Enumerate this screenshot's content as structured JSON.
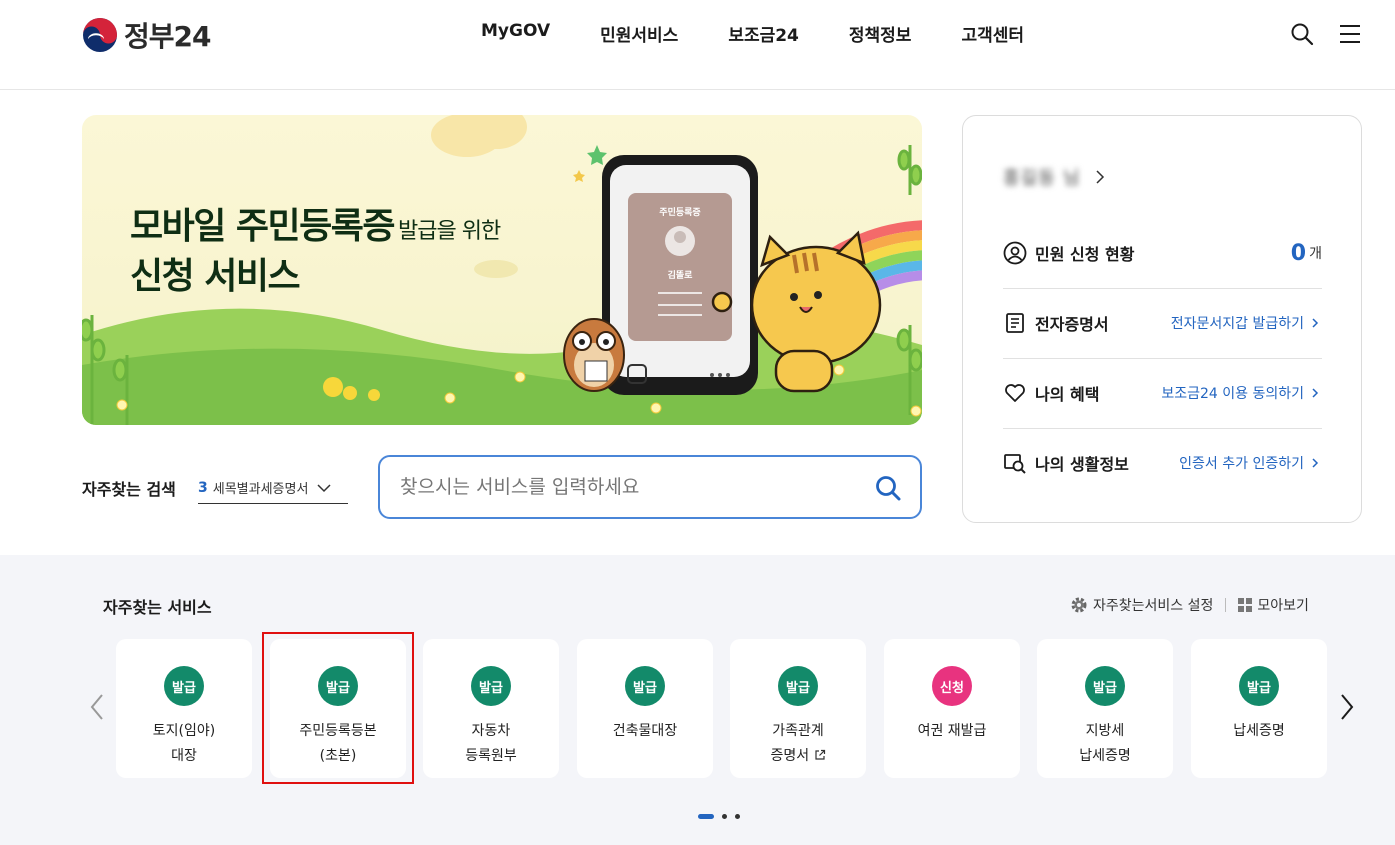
{
  "header": {
    "logo_text": "정부24",
    "nav": [
      "MyGOV",
      "민원서비스",
      "보조금24",
      "정책정보",
      "고객센터"
    ]
  },
  "banner": {
    "title_line1": "모바일 주민등록증",
    "title_line1_small": "발급을 위한",
    "title_line2": "신청 서비스",
    "card_title": "주민등록증",
    "card_name": "김똘로"
  },
  "search": {
    "label": "자주찾는 검색",
    "select_num": "3",
    "select_text": "세목별과세증명서",
    "placeholder": "찾으시는 서비스를 입력하세요"
  },
  "side": {
    "user_name": "홍길동 님",
    "rows": [
      {
        "label": "민원 신청 현황",
        "count": "0",
        "unit": "개"
      },
      {
        "label": "전자증명서",
        "link": "전자문서지갑 발급하기"
      },
      {
        "label": "나의 혜택",
        "link": "보조금24 이용 동의하기"
      },
      {
        "label": "나의 생활정보",
        "link": "인증서 추가 인증하기"
      }
    ]
  },
  "favorites": {
    "title": "자주찾는 서비스",
    "settings_label": "자주찾는서비스 설정",
    "view_all_label": "모아보기",
    "cards": [
      {
        "badge": "발급",
        "line1": "토지(임야)",
        "line2": "대장",
        "color": "#138a6a"
      },
      {
        "badge": "발급",
        "line1": "주민등록등본",
        "line2": "(초본)",
        "color": "#138a6a"
      },
      {
        "badge": "발급",
        "line1": "자동차",
        "line2": "등록원부",
        "color": "#138a6a"
      },
      {
        "badge": "발급",
        "line1": "건축물대장",
        "line2": "",
        "color": "#138a6a"
      },
      {
        "badge": "발급",
        "line1": "가족관계",
        "line2": "증명서",
        "color": "#138a6a",
        "external": true
      },
      {
        "badge": "신청",
        "line1": "여권 재발급",
        "line2": "",
        "color": "#e8337f"
      },
      {
        "badge": "발급",
        "line1": "지방세",
        "line2": "납세증명",
        "color": "#138a6a"
      },
      {
        "badge": "발급",
        "line1": "납세증명",
        "line2": "",
        "color": "#138a6a"
      }
    ],
    "page_current": 1,
    "page_total": 3
  }
}
